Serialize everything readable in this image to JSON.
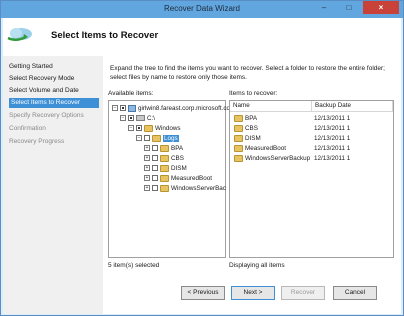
{
  "window": {
    "title": "Recover Data Wizard",
    "minimize_glyph": "–",
    "maximize_glyph": "□",
    "close_glyph": "×"
  },
  "header": {
    "title": "Select Items to Recover",
    "icon": "backup-cloud-icon"
  },
  "nav": {
    "items": [
      {
        "label": "Getting Started",
        "state": "normal"
      },
      {
        "label": "Select Recovery Mode",
        "state": "normal"
      },
      {
        "label": "Select Volume and Date",
        "state": "normal"
      },
      {
        "label": "Select Items to Recover",
        "state": "active"
      },
      {
        "label": "Specify Recovery Options",
        "state": "disabled"
      },
      {
        "label": "Confirmation",
        "state": "disabled"
      },
      {
        "label": "Recovery Progress",
        "state": "disabled"
      }
    ]
  },
  "content": {
    "description": "Expand the tree to find the items you want to recover. Select a folder to restore the entire folder; select files by name to restore only those items.",
    "available_label": "Available items:",
    "recover_label": "Items to recover:",
    "tree": [
      {
        "label": "girlwin8.fareast.corp.microsoft.co",
        "icon": "computer-icon",
        "expander": "−"
      },
      {
        "label": "C:\\",
        "icon": "drive-icon",
        "expander": "−"
      },
      {
        "label": "Windows",
        "icon": "folder-icon",
        "expander": "−"
      },
      {
        "label": "Logs",
        "icon": "folder-icon",
        "expander": "−"
      },
      {
        "label": "BPA",
        "icon": "folder-icon",
        "expander": "+"
      },
      {
        "label": "CBS",
        "icon": "folder-icon",
        "expander": "+"
      },
      {
        "label": "DISM",
        "icon": "folder-icon",
        "expander": "+"
      },
      {
        "label": "MeasuredBoot",
        "icon": "folder-icon",
        "expander": "+"
      },
      {
        "label": "WindowsServerBac",
        "icon": "folder-icon",
        "expander": "+"
      }
    ],
    "columns": [
      "Name",
      "Backup Date"
    ],
    "rows": [
      {
        "name": "BPA",
        "date": "12/13/2011 1"
      },
      {
        "name": "CBS",
        "date": "12/13/2011 1"
      },
      {
        "name": "DISM",
        "date": "12/13/2011 1"
      },
      {
        "name": "MeasuredBoot",
        "date": "12/13/2011 1"
      },
      {
        "name": "WindowsServerBackup",
        "date": "12/13/2011 1"
      }
    ],
    "selected_count": "5 item(s) selected",
    "displaying": "Displaying all items"
  },
  "buttons": {
    "previous": "< Previous",
    "next": "Next >",
    "recover": "Recover",
    "cancel": "Cancel"
  },
  "colors": {
    "accent": "#3d8fd6",
    "titlebar": "#62a6e0",
    "close": "#c8423a",
    "folder": "#e8c361"
  }
}
